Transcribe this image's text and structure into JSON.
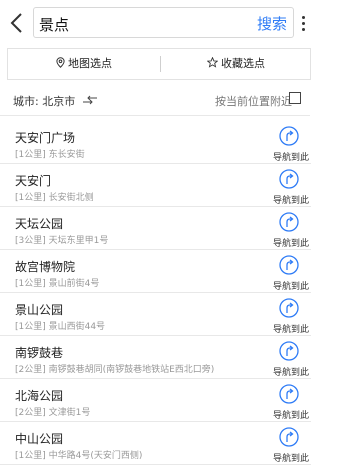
{
  "header": {
    "search_value": "景点",
    "search_button": "搜索"
  },
  "options": {
    "map_select": "地图选点",
    "favorite_select": "收藏选点"
  },
  "city": {
    "label": "城市: 北京市",
    "nearby": "按当前位置附近",
    "nearby_checked": false
  },
  "results": [
    {
      "name": "天安门广场",
      "sub": "[1公里]  东长安街",
      "nav": "导航到此"
    },
    {
      "name": "天安门",
      "sub": "[1公里]  长安街北侧",
      "nav": "导航到此"
    },
    {
      "name": "天坛公园",
      "sub": "[3公里]  天坛东里甲1号",
      "nav": "导航到此"
    },
    {
      "name": "故宫博物院",
      "sub": "[1公里]  景山前街4号",
      "nav": "导航到此"
    },
    {
      "name": "景山公园",
      "sub": "[1公里]  景山西街44号",
      "nav": "导航到此"
    },
    {
      "name": "南锣鼓巷",
      "sub": "[2公里]  南锣鼓巷胡同(南锣鼓巷地铁站E西北口旁)",
      "nav": "导航到此"
    },
    {
      "name": "北海公园",
      "sub": "[2公里]  文津街1号",
      "nav": "导航到此"
    },
    {
      "name": "中山公园",
      "sub": "[1公里]  中华路4号(天安门西侧)",
      "nav": "导航到此"
    }
  ],
  "colors": {
    "accent": "#2f7cf6"
  }
}
